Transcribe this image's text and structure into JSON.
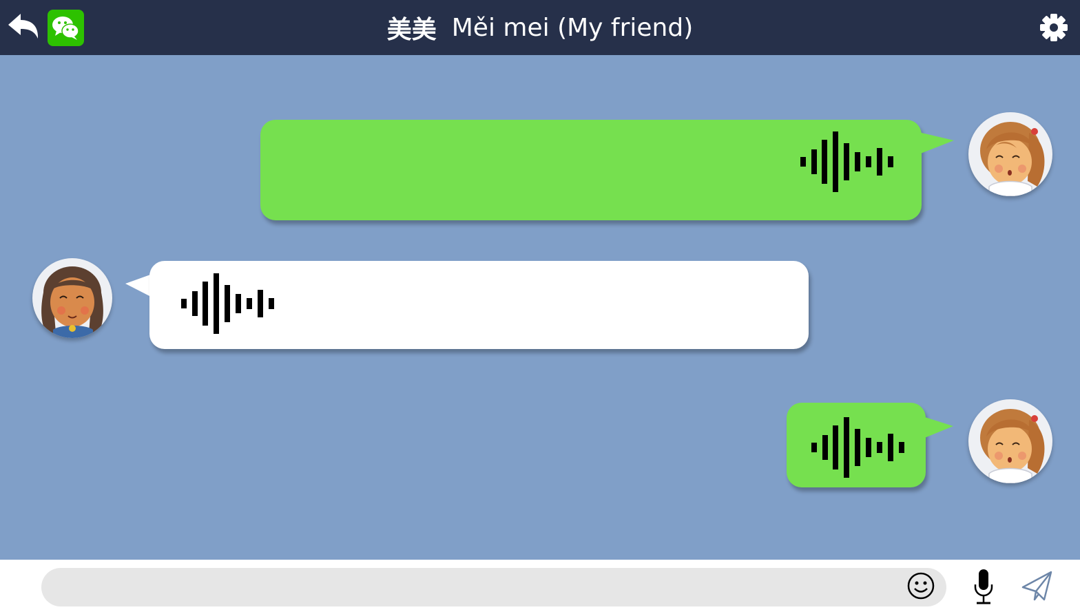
{
  "header": {
    "title_hanzi": "美美",
    "title_pinyin": "Měi mei (My friend)",
    "back_icon": "back-arrow-icon",
    "app_icon": "wechat-icon",
    "settings_icon": "gear-icon",
    "bar_color": "#26304a"
  },
  "chat": {
    "background_color": "#809fc8",
    "messages": [
      {
        "sender": "me",
        "type": "voice",
        "bubble_color": "#76e04f",
        "icon": "voice-waveform-icon"
      },
      {
        "sender": "friend",
        "type": "voice",
        "bubble_color": "#ffffff",
        "icon": "voice-waveform-icon"
      },
      {
        "sender": "me",
        "type": "voice",
        "bubble_color": "#76e04f",
        "icon": "voice-waveform-icon"
      }
    ]
  },
  "input_bar": {
    "placeholder": "",
    "emoji_icon": "emoji-icon",
    "mic_icon": "microphone-icon",
    "send_icon": "paper-plane-send-icon"
  }
}
